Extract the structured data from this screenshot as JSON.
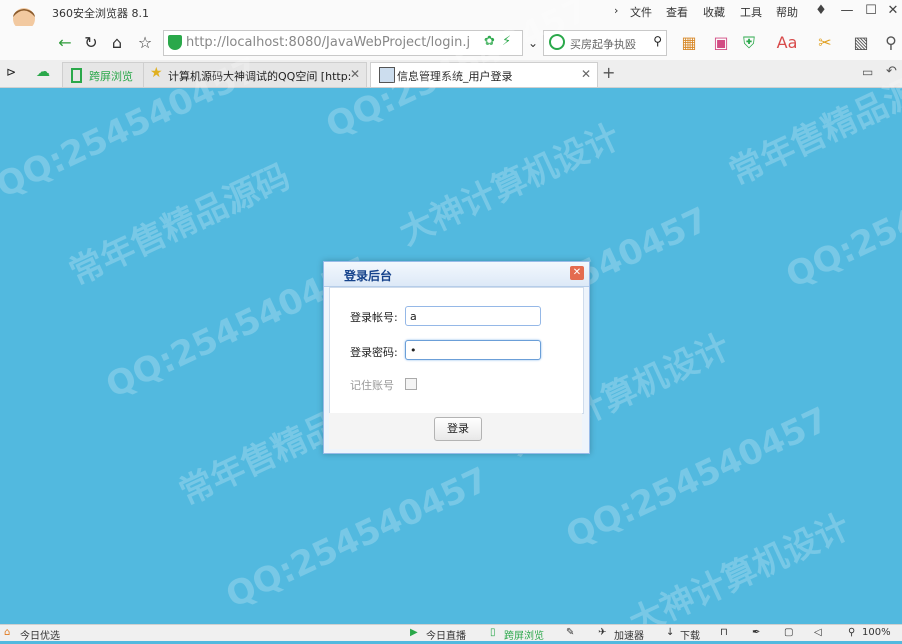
{
  "browser": {
    "app_title": "360安全浏览器 8.1",
    "menu": [
      "文件",
      "查看",
      "收藏",
      "工具",
      "帮助"
    ],
    "url_text": "http://localhost:8080/JavaWebProject/login.j",
    "search_text": "买房起争执殴",
    "tabs": [
      {
        "label": "跨屏浏览"
      },
      {
        "label": "计算机源码大神调试的QQ空间 [http:"
      },
      {
        "label": "信息管理系统_用户登录"
      }
    ]
  },
  "dialog": {
    "title": "登录后台",
    "username_label": "登录帐号:",
    "username_value": "a",
    "password_label": "登录密码:",
    "password_value": "•",
    "remember_label": "记住账号",
    "login_button": "登录"
  },
  "statusbar": {
    "left": "今日优选",
    "live": "今日直播",
    "cross": "跨屏浏览",
    "accelerator": "加速器",
    "download": "下载",
    "zoom": "100%"
  },
  "watermarks": [
    "QQ:254540457",
    "常年售精品源码",
    "大神计算机设计"
  ]
}
